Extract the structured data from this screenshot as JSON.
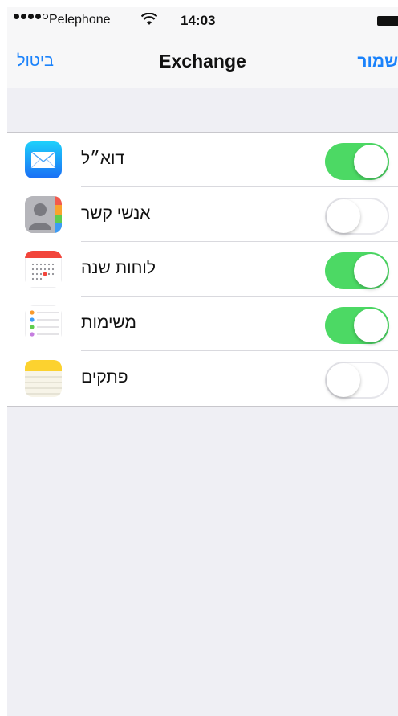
{
  "status_bar": {
    "carrier": "Pelephone",
    "time": "14:03",
    "signal_bars": 4,
    "signal_total": 5
  },
  "nav": {
    "cancel_label": "ביטול",
    "title": "Exchange",
    "save_label": "שמור"
  },
  "colors": {
    "accent": "#1a82fb",
    "toggle_on": "#4cd964",
    "background": "#efeff4"
  },
  "items": [
    {
      "label": "דוא״ל",
      "icon": "mail-icon",
      "enabled": true
    },
    {
      "label": "אנשי קשר",
      "icon": "contacts-icon",
      "enabled": false
    },
    {
      "label": "לוחות שנה",
      "icon": "calendar-icon",
      "enabled": true
    },
    {
      "label": "משימות",
      "icon": "reminders-icon",
      "enabled": true
    },
    {
      "label": "פתקים",
      "icon": "notes-icon",
      "enabled": false
    }
  ]
}
